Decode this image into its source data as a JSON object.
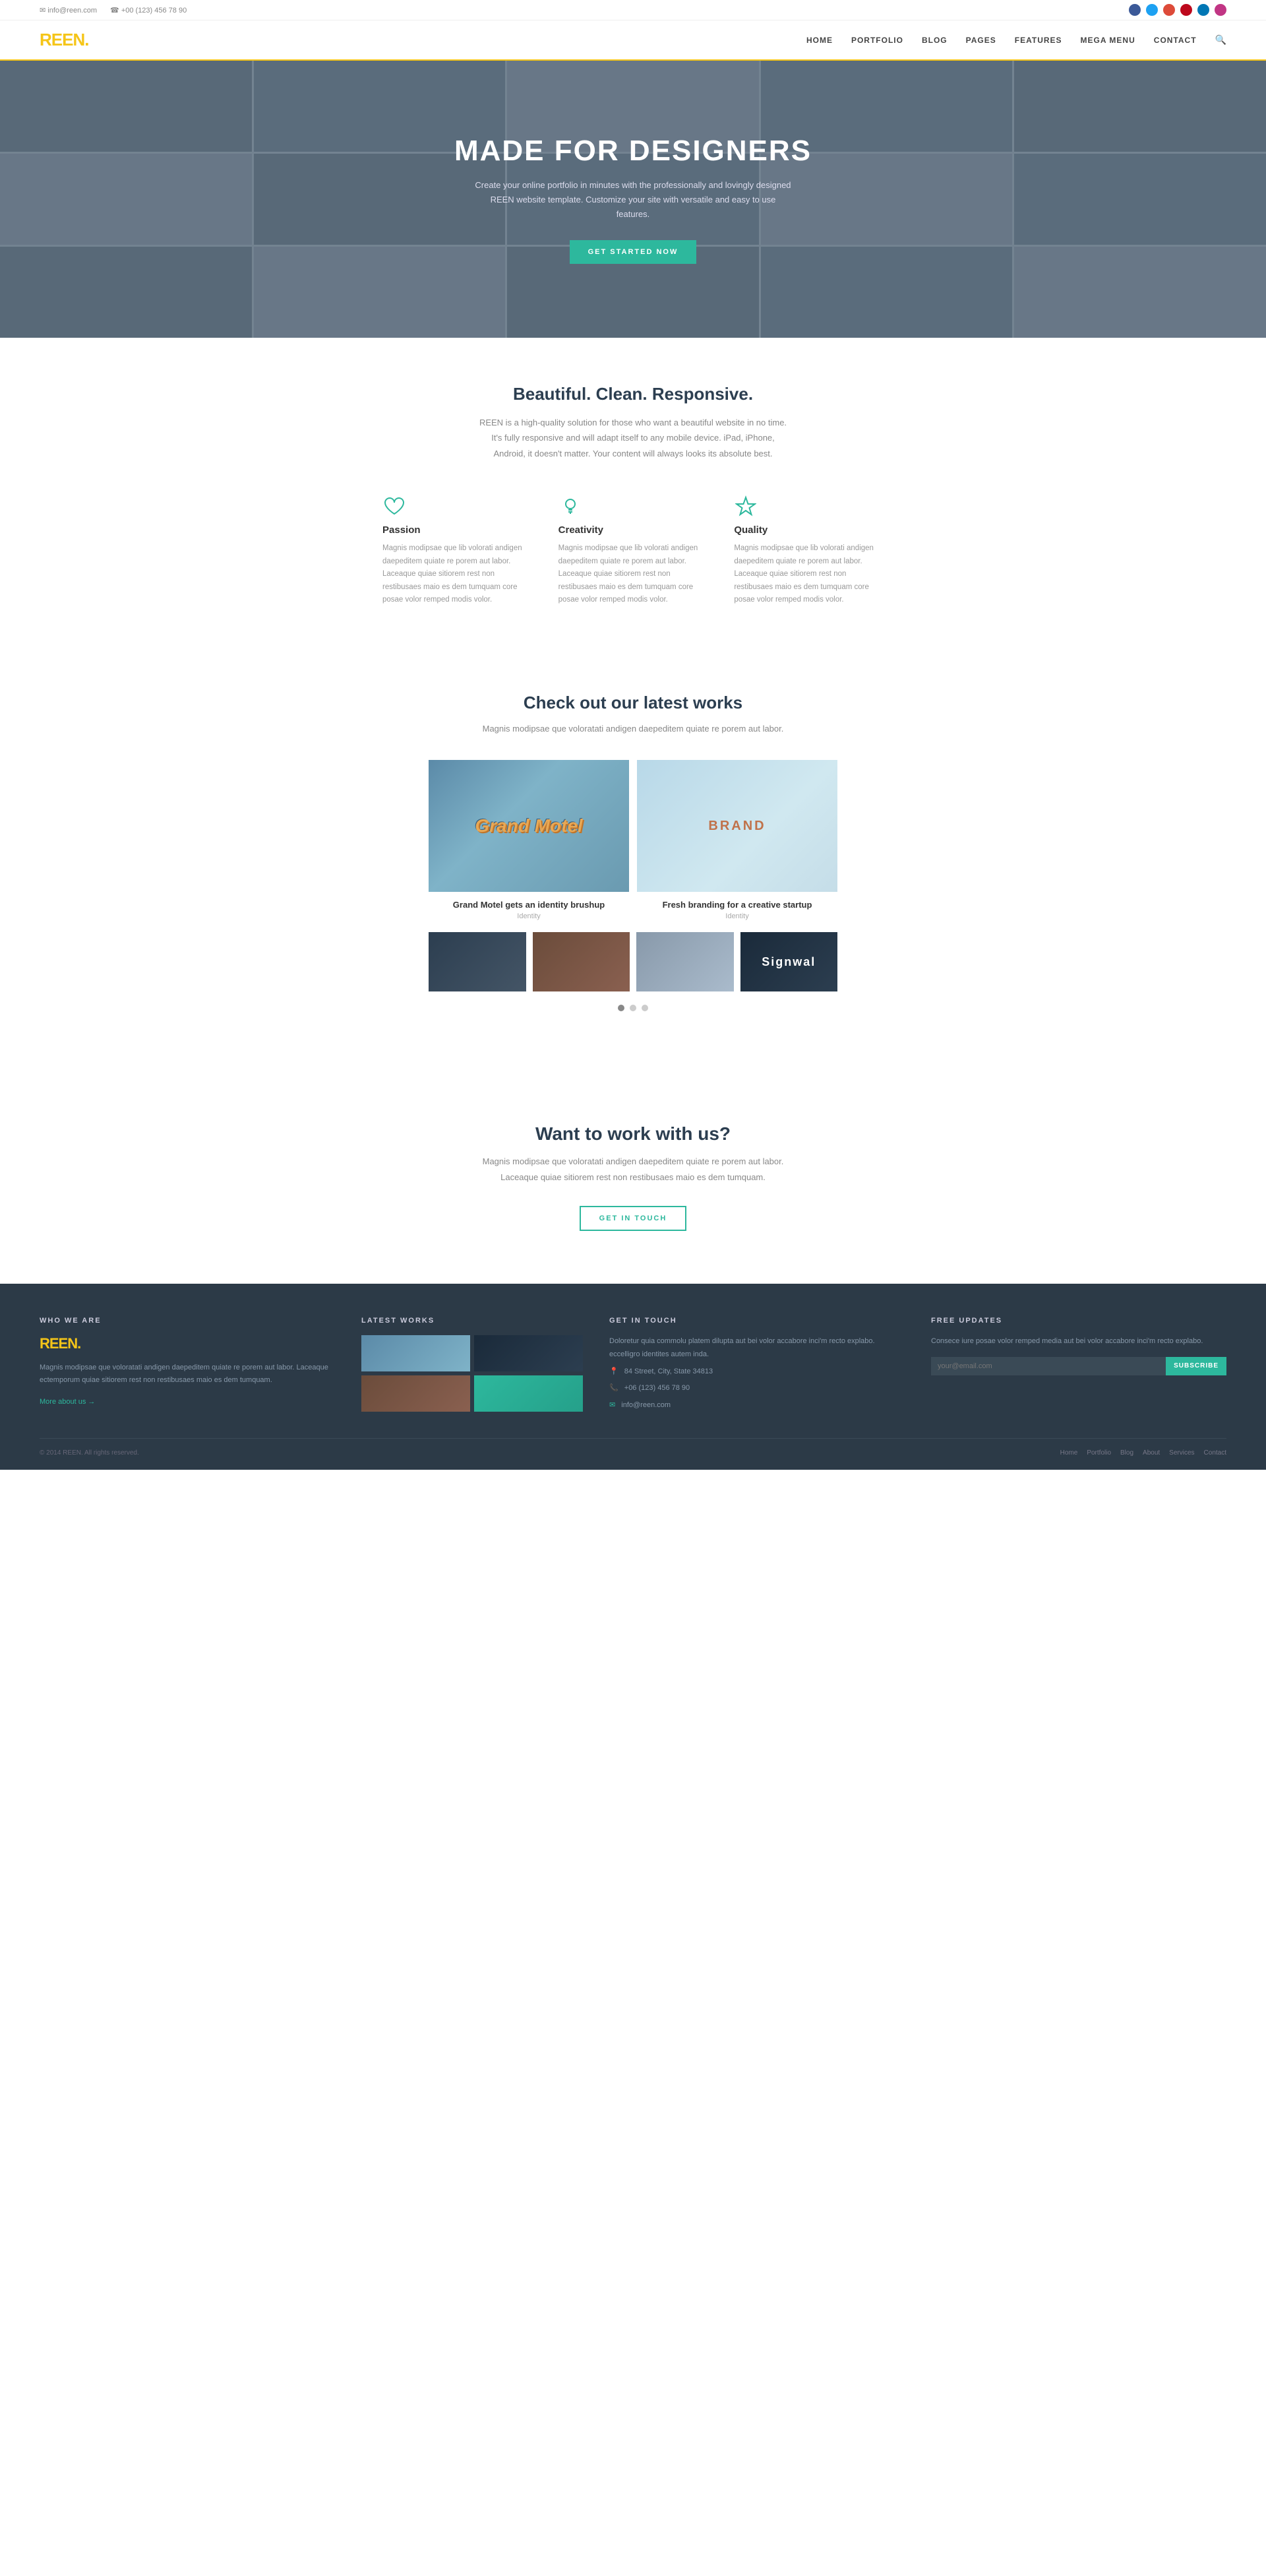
{
  "topbar": {
    "email": "info@reen.com",
    "phone": "+00 (123) 456 78 90",
    "email_icon": "✉",
    "phone_icon": "☎"
  },
  "header": {
    "logo_text": "REEN",
    "logo_dot": ".",
    "nav_items": [
      {
        "label": "HOME",
        "href": "#"
      },
      {
        "label": "PORTFOLIO",
        "href": "#"
      },
      {
        "label": "BLOG",
        "href": "#"
      },
      {
        "label": "PAGES",
        "href": "#"
      },
      {
        "label": "FEATURES",
        "href": "#"
      },
      {
        "label": "MEGA MENU",
        "href": "#"
      },
      {
        "label": "CONTACT",
        "href": "#"
      }
    ]
  },
  "hero": {
    "title": "MADE FOR DESIGNERS",
    "subtitle": "Create your online portfolio in minutes with the professionally and lovingly designed REEN website template. Customize your site with versatile and easy to use features.",
    "cta_label": "GET STARTED NOW"
  },
  "features_section": {
    "title": "Beautiful. Clean. Responsive.",
    "subtitle": "REEN is a high-quality solution for those who want a beautiful website in no time. It's fully responsive and will adapt itself to any mobile device. iPad, iPhone, Android, it doesn't matter. Your content will always looks its absolute best.",
    "items": [
      {
        "icon": "heart",
        "title": "Passion",
        "desc": "Magnis modipsae que lib volorati andigen daepeditem quiate re porem aut labor. Laceaque quiae sitiorem rest non restibusaes maio es dem tumquam core posae volor remped modis volor."
      },
      {
        "icon": "bulb",
        "title": "Creativity",
        "desc": "Magnis modipsae que lib volorati andigen daepeditem quiate re porem aut labor. Laceaque quiae sitiorem rest non restibusaes maio es dem tumquam core posae volor remped modis volor."
      },
      {
        "icon": "star",
        "title": "Quality",
        "desc": "Magnis modipsae que lib volorati andigen daepeditem quiate re porem aut labor. Laceaque quiae sitiorem rest non restibusaes maio es dem tumquam core posae volor remped modis volor."
      }
    ]
  },
  "portfolio_section": {
    "title": "Check out our latest works",
    "subtitle": "Magnis modipsae que voloratati andigen daepeditem quiate re porem aut labor.",
    "main_items": [
      {
        "title": "Grand Motel gets an identity brushup",
        "category": "Identity",
        "thumb_class": "thumb-grand-motel"
      },
      {
        "title": "Fresh branding for a creative startup",
        "category": "Identity",
        "thumb_class": "thumb-fresh-branding"
      }
    ],
    "small_items": [
      {
        "thumb_class": "thumb-sm-1"
      },
      {
        "thumb_class": "thumb-sm-2"
      },
      {
        "thumb_class": "thumb-sm-3"
      },
      {
        "thumb_class": "thumb-sm-4"
      }
    ]
  },
  "cta_section": {
    "title": "Want to work with us?",
    "subtitle": "Magnis modipsae que voloratati andigen daepeditem quiate re porem aut labor.\nLaceaque quiae sitiorem rest non restibusaes maio es dem tumquam.",
    "button_label": "GET IN TOUCH"
  },
  "footer": {
    "who_we_are": {
      "col_title": "WHO WE ARE",
      "logo": "REEN",
      "logo_dot": ".",
      "desc": "Magnis modipsae que voloratati andigen daepeditem quiate re porem aut labor. Laceaque ectemporum quiae sitiorem rest non restibusaes maio es dem tumquam.",
      "link_label": "More about us →"
    },
    "latest_works": {
      "col_title": "LATEST WORKS"
    },
    "get_in_touch": {
      "col_title": "GET IN TOUCH",
      "desc": "Doloretur quia commolu platem dilupta aut bei volor accabore inci'm recto explabo. eccelligro identites autem inda.",
      "address": "84 Street, City, State 34813",
      "phone": "+06 (123) 456 78 90",
      "email": "info@reen.com"
    },
    "free_updates": {
      "col_title": "FREE UPDATES",
      "desc": "Consece iure posae volor remped media aut bei volor accabore inci'm recto explabo.",
      "input_placeholder": "your@email.com",
      "button_label": "SUBSCRIBE"
    },
    "bottom": {
      "copyright": "© 2014 REEN. All rights reserved.",
      "nav_items": [
        {
          "label": "Home"
        },
        {
          "label": "Portfolio"
        },
        {
          "label": "Blog"
        },
        {
          "label": "About"
        },
        {
          "label": "Services"
        },
        {
          "label": "Contact"
        }
      ]
    }
  }
}
